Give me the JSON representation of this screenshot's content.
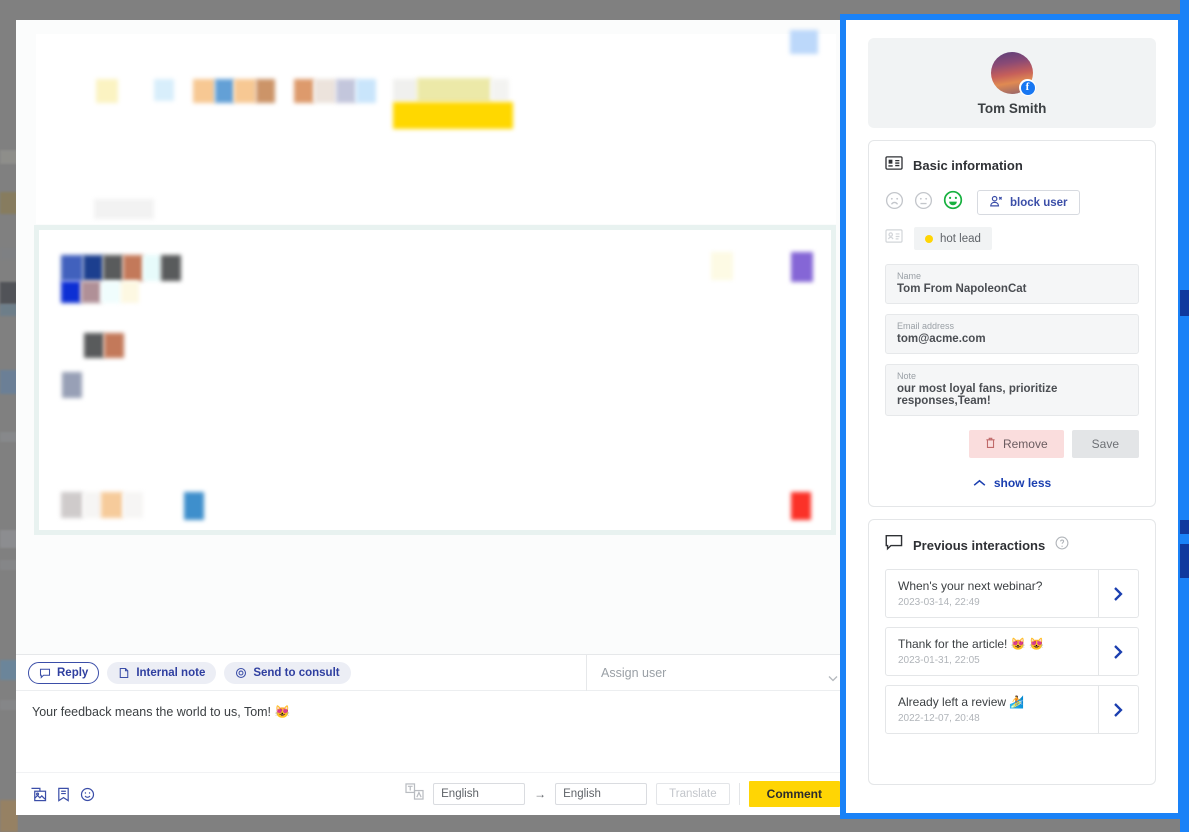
{
  "sidebar": {
    "profile": {
      "name": "Tom Smith",
      "network_badge": "facebook-icon",
      "avatar": "user-avatar-photo"
    },
    "basic_info": {
      "title": "Basic information",
      "icon": "contact-card-icon",
      "moods": [
        {
          "name": "mood-sad-icon",
          "state": "inactive"
        },
        {
          "name": "mood-neutral-icon",
          "state": "inactive"
        },
        {
          "name": "mood-happy-icon",
          "state": "active"
        }
      ],
      "block_user_label": "block user",
      "tag_icon": "contact-card-outline-icon",
      "tag_label": "hot lead",
      "tag_dot_color": "#ffd504",
      "fields": [
        {
          "label": "Name",
          "value": "Tom From NapoleonCat"
        },
        {
          "label": "Email address",
          "value": "tom@acme.com"
        },
        {
          "label": "Note",
          "value": "our most loyal fans, prioritize responses,Team!"
        }
      ],
      "remove_label": "Remove",
      "save_label": "Save",
      "show_less_label": "show less"
    },
    "interactions": {
      "title": "Previous interactions",
      "icon": "chat-bubble-icon",
      "help_icon": "help-circle-icon",
      "items": [
        {
          "text": "When's your next webinar?",
          "date": "2023-03-14, 22:49"
        },
        {
          "text": "Thank for the article! 😻 😻",
          "date": "2023-01-31, 22:05"
        },
        {
          "text": "Already left a review 🏄",
          "date": "2022-12-07, 20:48"
        }
      ]
    }
  },
  "composer": {
    "tabs": [
      {
        "label": "Reply",
        "icon": "reply-bubble-icon",
        "active": true
      },
      {
        "label": "Internal note",
        "icon": "note-icon",
        "active": false
      },
      {
        "label": "Send to consult",
        "icon": "consult-icon",
        "active": false
      }
    ],
    "assign_placeholder": "Assign user",
    "reply_text": "Your feedback means the world to us, Tom! 😻",
    "tools": [
      {
        "name": "insert-image-icon"
      },
      {
        "name": "saved-reply-icon"
      },
      {
        "name": "emoji-icon"
      }
    ],
    "translate": {
      "icon": "translate-icon",
      "source_language": "English",
      "target_language": "English",
      "button_label": "Translate"
    },
    "submit_label": "Comment",
    "submit_color": "#ffd504"
  },
  "highlight": {
    "color": "#1a82f7",
    "border_width": "6px"
  }
}
